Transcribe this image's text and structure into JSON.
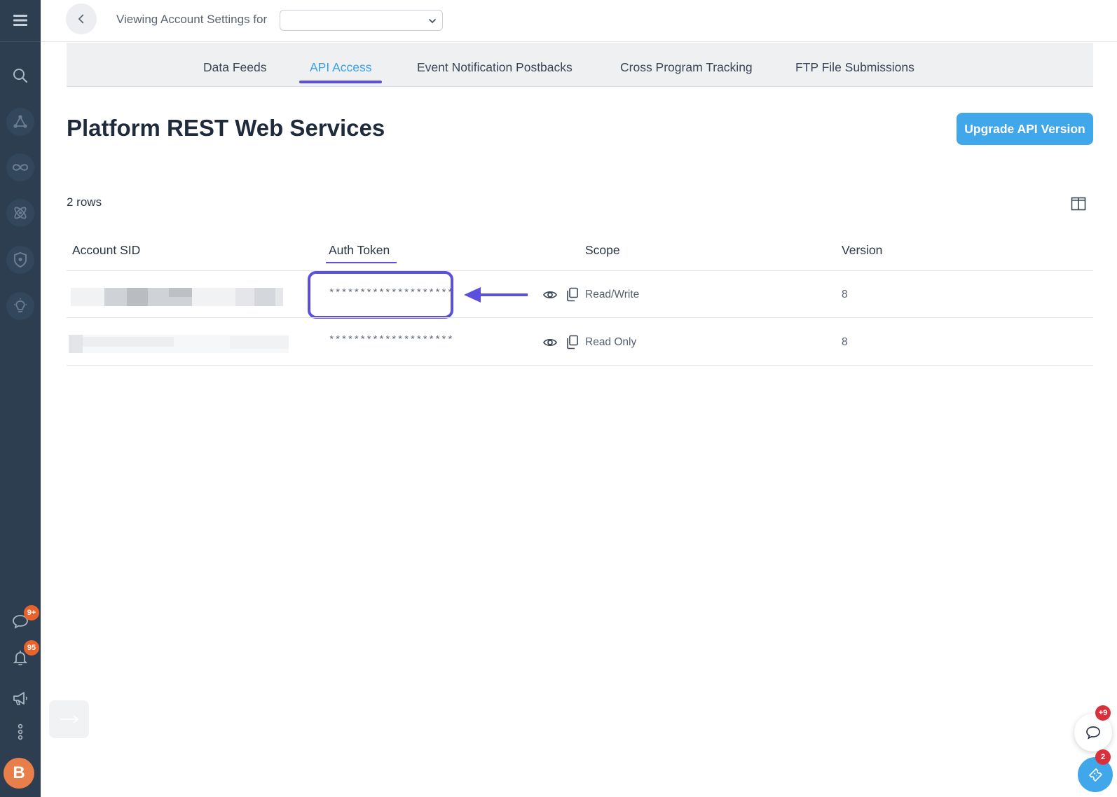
{
  "topbar": {
    "viewing_label": "Viewing Account Settings for",
    "account_select_value": ""
  },
  "tabs": [
    {
      "label": "Data Feeds",
      "active": false
    },
    {
      "label": "API Access",
      "active": true
    },
    {
      "label": "Event Notification Postbacks",
      "active": false
    },
    {
      "label": "Cross Program Tracking",
      "active": false
    },
    {
      "label": "FTP File Submissions",
      "active": false
    }
  ],
  "page": {
    "title": "Platform REST Web Services",
    "upgrade_button": "Upgrade API Version",
    "rows_count": "2 rows"
  },
  "table": {
    "headers": [
      "Account SID",
      "Auth Token",
      "Scope",
      "Version"
    ],
    "rows": [
      {
        "account_sid": "",
        "auth_token": "********************",
        "scope": "Read/Write",
        "version": "8"
      },
      {
        "account_sid": "",
        "auth_token": "********************",
        "scope": "Read Only",
        "version": "8"
      }
    ]
  },
  "sidebar": {
    "icons": [
      "menu-icon",
      "search-icon",
      "network-icon",
      "infinity-icon",
      "atom-icon",
      "shield-icon",
      "lightbulb-icon",
      "chat-icon",
      "bell-icon",
      "megaphone-icon",
      "more-vertical-icon"
    ],
    "chat_badge": "9+",
    "bell_badge": "95",
    "avatar_initial": "B"
  },
  "widgets": {
    "chat_badge": "+9",
    "ticket_badge": "2"
  },
  "colors": {
    "sidebar": "#2c3e50",
    "accent": "#3fa7ea",
    "highlight": "#5b4fe0",
    "badge_orange": "#e8622c",
    "badge_red": "#d9303b"
  }
}
